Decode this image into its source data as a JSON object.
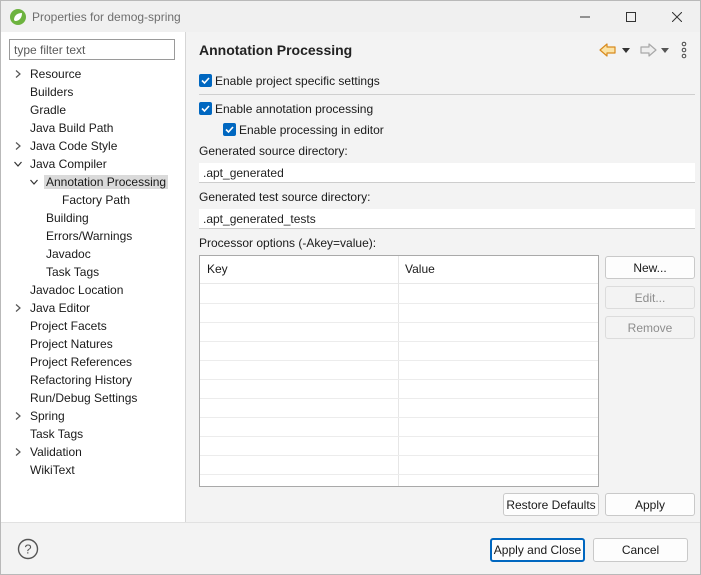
{
  "window": {
    "title": "Properties for demog-spring",
    "minimize_glyph": "—",
    "maximize_glyph": "☐",
    "close_glyph": "✕"
  },
  "filter": {
    "placeholder": "type filter text",
    "value": ""
  },
  "tree": [
    {
      "label": "Resource",
      "chevron": "right",
      "indent": 0,
      "selected": false
    },
    {
      "label": "Builders",
      "chevron": "none",
      "indent": 0,
      "selected": false
    },
    {
      "label": "Gradle",
      "chevron": "none",
      "indent": 0,
      "selected": false
    },
    {
      "label": "Java Build Path",
      "chevron": "none",
      "indent": 0,
      "selected": false
    },
    {
      "label": "Java Code Style",
      "chevron": "right",
      "indent": 0,
      "selected": false
    },
    {
      "label": "Java Compiler",
      "chevron": "down",
      "indent": 0,
      "selected": false
    },
    {
      "label": "Annotation Processing",
      "chevron": "down",
      "indent": 1,
      "selected": true
    },
    {
      "label": "Factory Path",
      "chevron": "none",
      "indent": 2,
      "selected": false
    },
    {
      "label": "Building",
      "chevron": "none",
      "indent": 1,
      "selected": false
    },
    {
      "label": "Errors/Warnings",
      "chevron": "none",
      "indent": 1,
      "selected": false
    },
    {
      "label": "Javadoc",
      "chevron": "none",
      "indent": 1,
      "selected": false
    },
    {
      "label": "Task Tags",
      "chevron": "none",
      "indent": 1,
      "selected": false
    },
    {
      "label": "Javadoc Location",
      "chevron": "none",
      "indent": 0,
      "selected": false
    },
    {
      "label": "Java Editor",
      "chevron": "right",
      "indent": 0,
      "selected": false
    },
    {
      "label": "Project Facets",
      "chevron": "none",
      "indent": 0,
      "selected": false
    },
    {
      "label": "Project Natures",
      "chevron": "none",
      "indent": 0,
      "selected": false
    },
    {
      "label": "Project References",
      "chevron": "none",
      "indent": 0,
      "selected": false
    },
    {
      "label": "Refactoring History",
      "chevron": "none",
      "indent": 0,
      "selected": false
    },
    {
      "label": "Run/Debug Settings",
      "chevron": "none",
      "indent": 0,
      "selected": false
    },
    {
      "label": "Spring",
      "chevron": "right",
      "indent": 0,
      "selected": false
    },
    {
      "label": "Task Tags",
      "chevron": "none",
      "indent": 0,
      "selected": false
    },
    {
      "label": "Validation",
      "chevron": "right",
      "indent": 0,
      "selected": false
    },
    {
      "label": "WikiText",
      "chevron": "none",
      "indent": 0,
      "selected": false
    }
  ],
  "page": {
    "title": "Annotation Processing",
    "enable_project_specific": {
      "label": "Enable project specific settings",
      "checked": true
    },
    "enable_annotation_processing": {
      "label": "Enable annotation processing",
      "checked": true
    },
    "enable_processing_in_editor": {
      "label": "Enable processing in editor",
      "checked": true
    },
    "generated_source_dir": {
      "label": "Generated source directory:",
      "value": ".apt_generated"
    },
    "generated_test_source_dir": {
      "label": "Generated test source directory:",
      "value": ".apt_generated_tests"
    },
    "processor_options": {
      "label": "Processor options (-Akey=value):",
      "columns": [
        "Key",
        "Value"
      ],
      "rows": []
    },
    "buttons": {
      "new": "New...",
      "edit": "Edit...",
      "remove": "Remove",
      "restore_defaults": "Restore Defaults",
      "apply": "Apply"
    }
  },
  "footer": {
    "help_glyph": "?",
    "apply_and_close": "Apply and Close",
    "cancel": "Cancel"
  },
  "colors": {
    "accent": "#0067c0",
    "back_arrow": "#e8a33d",
    "selection": "#dadada",
    "spring_green": "#6db33f"
  },
  "icons": {
    "back": "arrow-left-icon",
    "forward": "arrow-right-icon",
    "menu": "kebab-menu-icon",
    "help": "help-icon",
    "app": "spring-leaf-icon"
  }
}
